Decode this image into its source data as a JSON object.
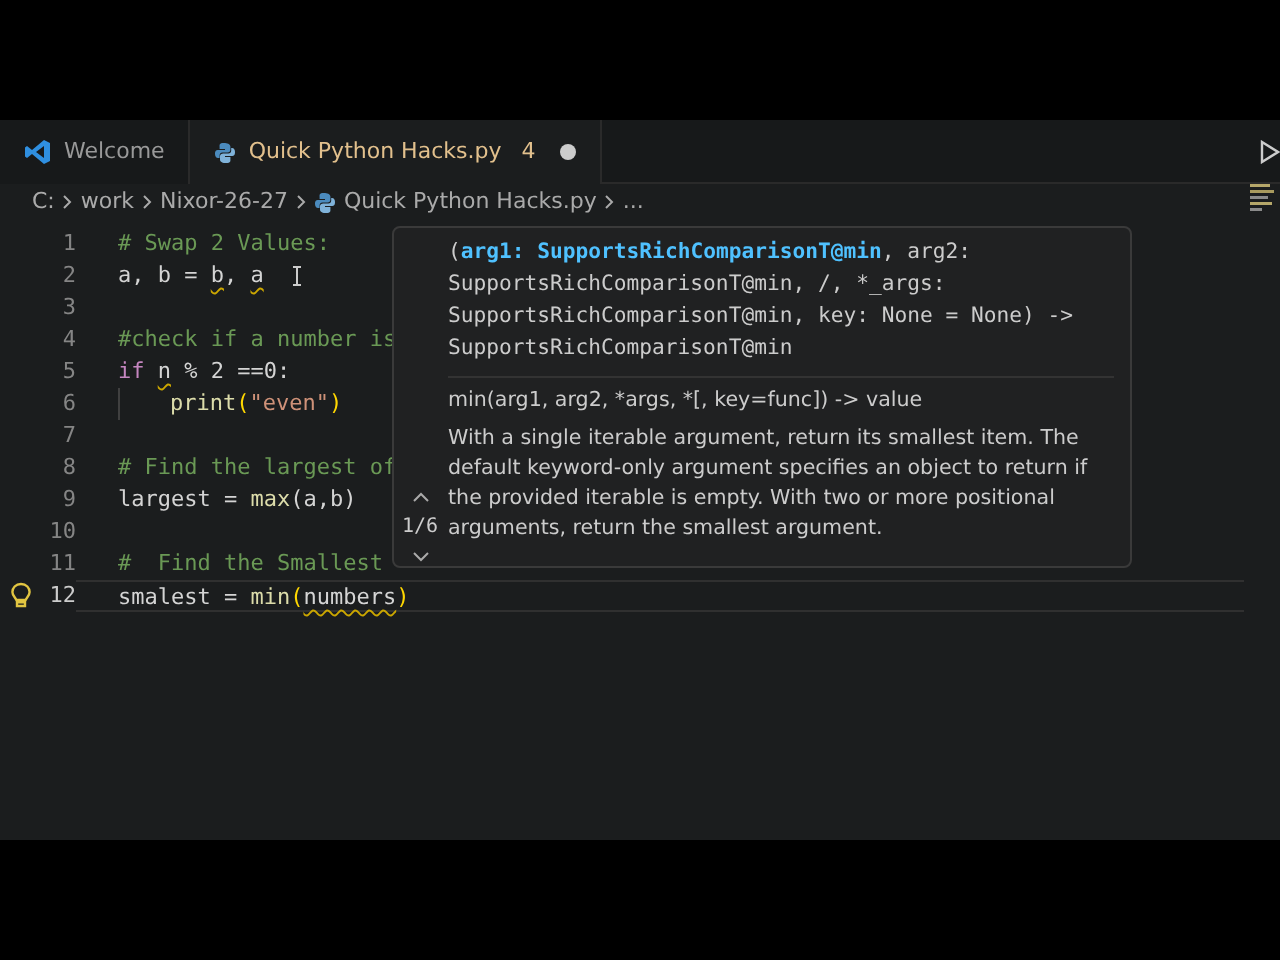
{
  "tabs": [
    {
      "label": "Welcome",
      "kind": "welcome",
      "selected": false
    },
    {
      "label": "Quick Python Hacks.py",
      "kind": "python",
      "selected": true,
      "problems": "4",
      "modified": true
    }
  ],
  "breadcrumb": [
    {
      "label": "C:",
      "kind": "folder"
    },
    {
      "label": "work",
      "kind": "folder"
    },
    {
      "label": "Nixor-26-27",
      "kind": "folder"
    },
    {
      "label": "Quick Python Hacks.py",
      "kind": "python"
    },
    {
      "label": "...",
      "kind": "more"
    }
  ],
  "lines": [
    {
      "number": "1",
      "tokens": [
        {
          "text": "# Swap 2 Values:",
          "kind": "comment"
        }
      ]
    },
    {
      "number": "2",
      "tokens": [
        {
          "text": "a, b = ",
          "kind": "plain"
        },
        {
          "text": "b",
          "kind": "plain",
          "squiggle": true
        },
        {
          "text": ", ",
          "kind": "plain"
        },
        {
          "text": "a",
          "kind": "plain",
          "squiggle": true
        }
      ]
    },
    {
      "number": "3"
    },
    {
      "number": "4",
      "tokens": [
        {
          "text": "#check if a number is",
          "kind": "comment"
        }
      ]
    },
    {
      "number": "5",
      "tokens": [
        {
          "text": "if",
          "kind": "keyword"
        },
        {
          "text": "n",
          "kind": "plain",
          "squiggle": true
        },
        {
          "text": " % 2 ==0:",
          "kind": "plain"
        }
      ]
    },
    {
      "number": "6",
      "indented": true,
      "tokens": [
        {
          "text": "print",
          "kind": "func"
        },
        {
          "text": "(",
          "kind": "paren"
        },
        {
          "text": "\"even\"",
          "kind": "string"
        },
        {
          "text": ")",
          "kind": "paren"
        }
      ]
    },
    {
      "number": "7"
    },
    {
      "number": "8",
      "tokens": [
        {
          "text": "# Find the largest of",
          "kind": "comment"
        }
      ]
    },
    {
      "number": "9",
      "tokens": [
        {
          "text": "largest = ",
          "kind": "plain"
        },
        {
          "text": "max",
          "kind": "func"
        },
        {
          "text": "(a,b)",
          "kind": "plain"
        }
      ]
    },
    {
      "number": "10"
    },
    {
      "number": "11",
      "tokens": [
        {
          "text": "#  Find the Smallest",
          "kind": "comment"
        }
      ]
    },
    {
      "number": "12",
      "current": true,
      "lightbulb": true,
      "tokens": [
        {
          "text": "smalest = ",
          "kind": "plain"
        },
        {
          "text": "min",
          "kind": "func"
        },
        {
          "text": "(",
          "kind": "paren"
        },
        {
          "text": "numbers",
          "kind": "plain",
          "squiggle": true
        },
        {
          "text": ")",
          "kind": "paren"
        }
      ]
    }
  ],
  "hover": {
    "signature": [
      {
        "text": "(",
        "kind": "plain"
      },
      {
        "text": "arg1: SupportsRichComparisonT@min",
        "kind": "active"
      },
      {
        "text": ", arg2: SupportsRichComparisonT@min, /, *_args: SupportsRichComparisonT@min, key: None = None) -> SupportsRichComparisonT@min",
        "kind": "plain"
      }
    ],
    "doc_signature": "min(arg1, arg2, *args, *[, key=func]) -> value",
    "description": "With a single iterable argument, return its smallest item. The default keyword-only argument specifies an object to return if the provided iterable is empty. With two or more positional arguments, return the smallest argument.",
    "pager": "1/6"
  }
}
